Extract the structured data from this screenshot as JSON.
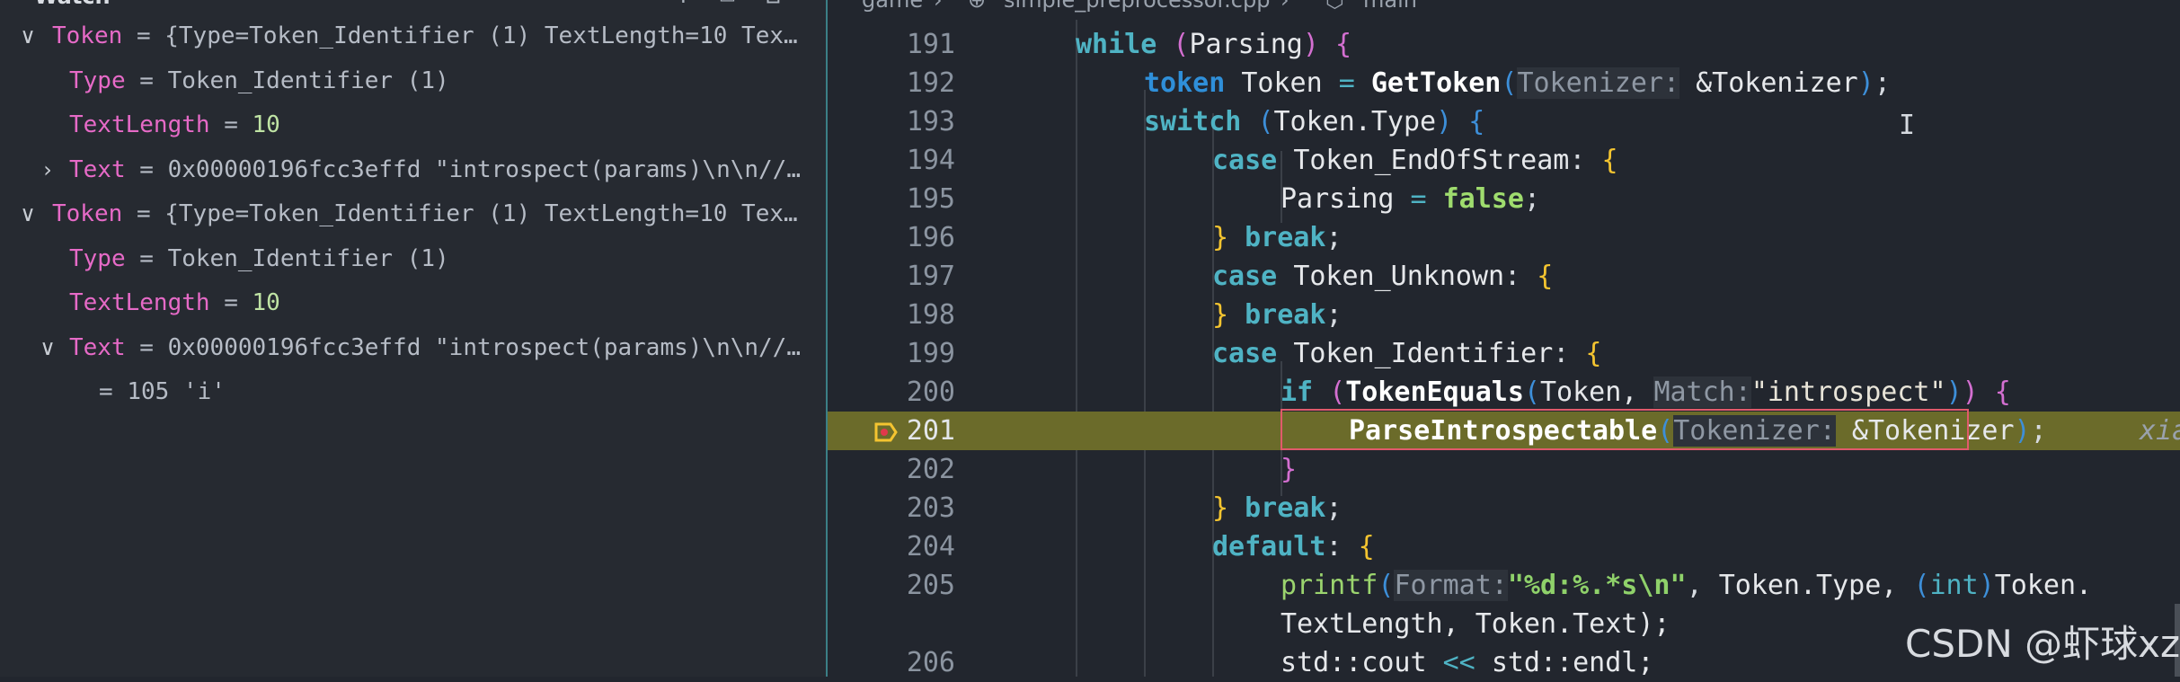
{
  "watch": {
    "header_title": "Watch",
    "rows": [
      {
        "name": "Token",
        "value": "{Type=Token_Identifier (1) TextLength=10 Tex…",
        "expanded": true
      },
      {
        "name": "Type",
        "value": "Token_Identifier (1)"
      },
      {
        "name": "TextLength",
        "value": "10"
      },
      {
        "name": "Text",
        "value": "0x00000196fcc3effd \"introspect(params)\\n\\n//…",
        "expanded": false
      },
      {
        "name": "Token",
        "value": "{Type=Token_Identifier (1) TextLength=10 Tex…",
        "expanded": true
      },
      {
        "name": "Type",
        "value": "Token_Identifier (1)"
      },
      {
        "name": "TextLength",
        "value": "10"
      },
      {
        "name": "Text",
        "value": "0x00000196fcc3effd \"introspect(params)\\n\\n//…",
        "expanded": true
      },
      {
        "name": "",
        "value": "105 'i'"
      }
    ],
    "equals": "="
  },
  "breadcrumb": {
    "folder": "game",
    "file": "simple_preprocessor.cpp",
    "symbol": "main"
  },
  "editor": {
    "lines": [
      {
        "n": "191"
      },
      {
        "n": "192"
      },
      {
        "n": "193"
      },
      {
        "n": "194"
      },
      {
        "n": "195"
      },
      {
        "n": "196"
      },
      {
        "n": "197"
      },
      {
        "n": "198"
      },
      {
        "n": "199"
      },
      {
        "n": "200"
      },
      {
        "n": "201"
      },
      {
        "n": "202"
      },
      {
        "n": "203"
      },
      {
        "n": "204"
      },
      {
        "n": "205"
      },
      {
        "n": ""
      },
      {
        "n": "206"
      }
    ],
    "tokens": {
      "while": "while",
      "Parsing": "Parsing",
      "token": "token",
      "Token": "Token",
      "GetToken": "GetToken",
      "hint_tokenizer": "Tokenizer:",
      "amp_tokenizer": "&Tokenizer",
      "switch": "switch",
      "Token_Type": "Token.Type",
      "case": "case",
      "EndOfStream": "Token_EndOfStream",
      "ParsingEq": "Parsing",
      "false": "false",
      "break": "break",
      "Unknown": "Token_Unknown",
      "Identifier": "Token_Identifier",
      "if": "if",
      "TokenEquals": "TokenEquals",
      "hint_match": "Match:",
      "introspect": "\"introspect\"",
      "ParseIntrospectable": "ParseIntrospectable",
      "default": "default",
      "printf": "printf",
      "hint_format": "Format:",
      "fmt_str": "\"%d:%.*s\\n\"",
      "Token_Type2": "Token.Type,",
      "int": "int",
      "TokenDot": "Token.",
      "TextLength_line": "TextLength, Token.Text);",
      "std_cout": "std::cout",
      "shl": "<<",
      "std_endl": "std::endl;"
    },
    "inline_value": "xia"
  },
  "watermark": "CSDN @虾球xz"
}
